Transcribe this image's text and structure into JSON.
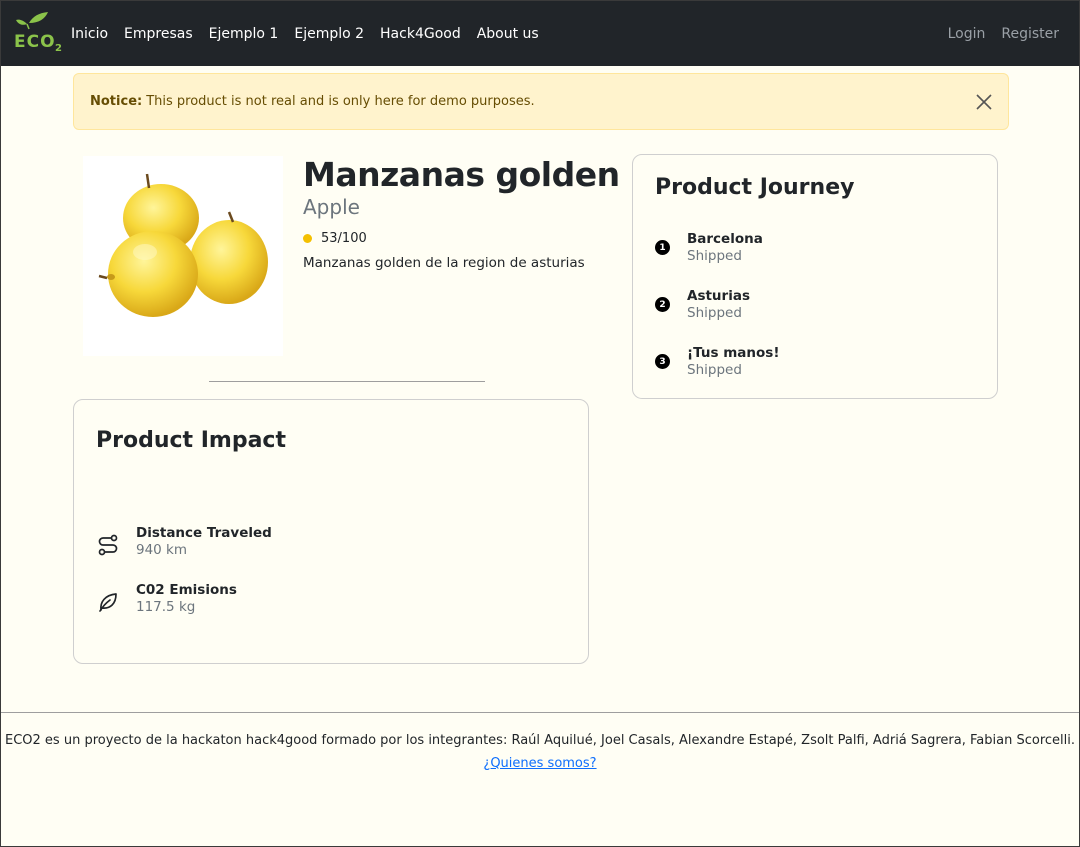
{
  "nav": {
    "logo_text": "ECO2",
    "links": [
      "Inicio",
      "Empresas",
      "Ejemplo 1",
      "Ejemplo 2",
      "Hack4Good",
      "About us"
    ],
    "login": "Login",
    "register": "Register"
  },
  "alert": {
    "label": "Notice:",
    "message": "This product is not real and is only here for demo purposes."
  },
  "product": {
    "name": "Manzanas golden",
    "category": "Apple",
    "score": "53/100",
    "description": "Manzanas golden de la region de asturias"
  },
  "impact": {
    "title": "Product Impact",
    "items": [
      {
        "label": "Distance Traveled",
        "value": "940 km",
        "icon": "route-icon"
      },
      {
        "label": "C02 Emisions",
        "value": "117.5 kg",
        "icon": "leaf-icon"
      }
    ]
  },
  "journey": {
    "title": "Product Journey",
    "steps": [
      {
        "number": "1",
        "location": "Barcelona",
        "status": "Shipped"
      },
      {
        "number": "2",
        "location": "Asturias",
        "status": "Shipped"
      },
      {
        "number": "3",
        "location": "¡Tus manos!",
        "status": "Shipped"
      }
    ]
  },
  "footer": {
    "text": "ECO2 es un proyecto de la hackaton hack4good formado por los integrantes: Raúl Aquilué, Joel Casals, Alexandre Estapé, Zsolt Palfi, Adriá Sagrera, Fabian Scorcelli.",
    "link": "¿Quienes somos?"
  },
  "colors": {
    "navbar": "#212529",
    "background": "#fffef4",
    "alert_bg": "#fff3cd",
    "score_dot": "#f4c000",
    "brand_green": "#8bc34a",
    "link": "#0d6efd"
  }
}
